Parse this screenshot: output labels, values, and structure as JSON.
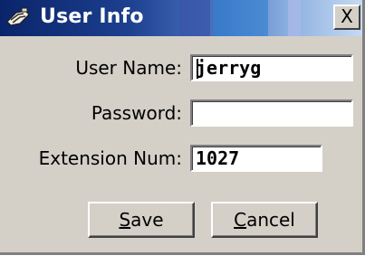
{
  "window": {
    "title": "User Info",
    "close_label": "X"
  },
  "form": {
    "username": {
      "label": "User Name:",
      "value": "jerryg"
    },
    "password": {
      "label": "Password:",
      "value": ""
    },
    "extension": {
      "label": "Extension Num:",
      "value": "1027"
    }
  },
  "buttons": {
    "save": {
      "accel": "S",
      "rest": "ave"
    },
    "cancel": {
      "accel": "C",
      "rest": "ancel"
    }
  },
  "colors": {
    "titlebar_start": "#0a246a",
    "titlebar_end": "#c6daf2",
    "window_face": "#d4d0c8"
  },
  "icons": {
    "title_icon": "phone-icon"
  }
}
